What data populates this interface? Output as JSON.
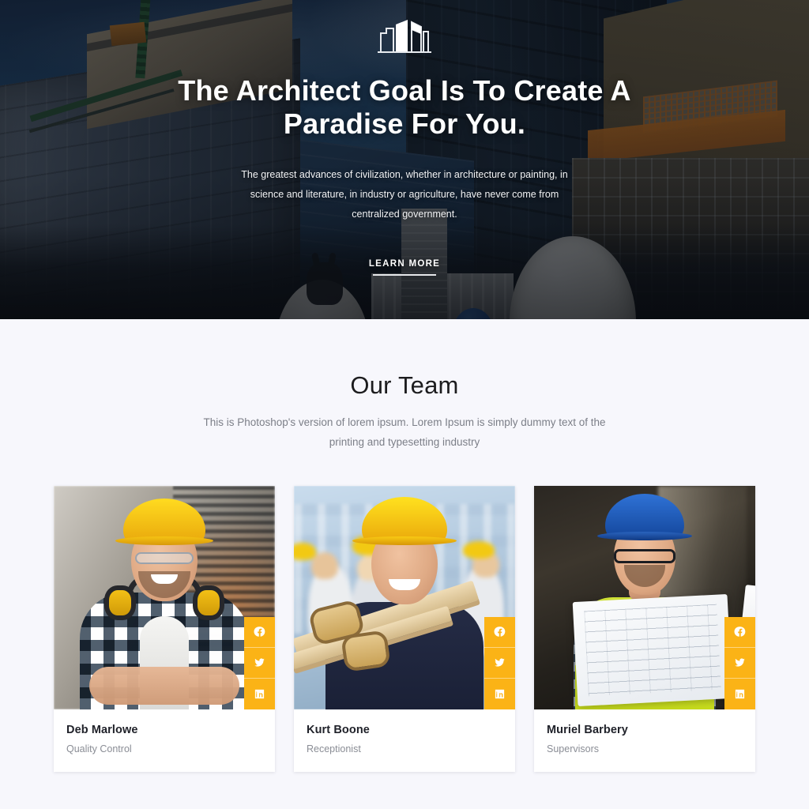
{
  "hero": {
    "logo_icon": "buildings-logo-icon",
    "title": "The Architect Goal Is To Create A Paradise For You.",
    "subtitle": "The greatest advances of civilization, whether in architecture or painting, in science and literature, in industry or agriculture, have never come from centralized government.",
    "cta_label": "LEARN MORE",
    "background_description": "Construction site with high-rise buildings, tower crane and hard hats under a blue sky, darkened by an overlay"
  },
  "team": {
    "heading": "Our Team",
    "subheading": "This is Photoshop's version of lorem ipsum. Lorem Ipsum is simply dummy text of the printing and typesetting industry",
    "members": [
      {
        "name": "Deb Marlowe",
        "role": "Quality Control",
        "photo_description": "Smiling worker in a yellow hard hat, safety glasses and ear defenders, wearing a blue plaid shirt with arms crossed",
        "social": [
          {
            "icon": "facebook-icon",
            "label": "Facebook"
          },
          {
            "icon": "twitter-icon",
            "label": "Twitter"
          },
          {
            "icon": "linkedin-icon",
            "label": "LinkedIn"
          }
        ]
      },
      {
        "name": "Kurt Boone",
        "role": "Receptionist",
        "photo_description": "Smiling carpenter in a yellow hard hat and navy shirt carrying timber on his shoulder with leather work gloves",
        "social": [
          {
            "icon": "facebook-icon",
            "label": "Facebook"
          },
          {
            "icon": "twitter-icon",
            "label": "Twitter"
          },
          {
            "icon": "linkedin-icon",
            "label": "LinkedIn"
          }
        ]
      },
      {
        "name": "Muriel Barbery",
        "role": "Supervisors",
        "photo_description": "Engineer in a blue hard hat and glasses wearing a yellow hi-vis vest, reading a large blueprint",
        "social": [
          {
            "icon": "facebook-icon",
            "label": "Facebook"
          },
          {
            "icon": "twitter-icon",
            "label": "Twitter"
          },
          {
            "icon": "linkedin-icon",
            "label": "LinkedIn"
          }
        ]
      }
    ]
  },
  "colors": {
    "accent": "#fbb316",
    "page_background": "#f7f7fc",
    "card_background": "#ffffff",
    "heading_text": "#1c1c1e",
    "muted_text": "#8a8d95",
    "hero_text": "#ffffff"
  }
}
